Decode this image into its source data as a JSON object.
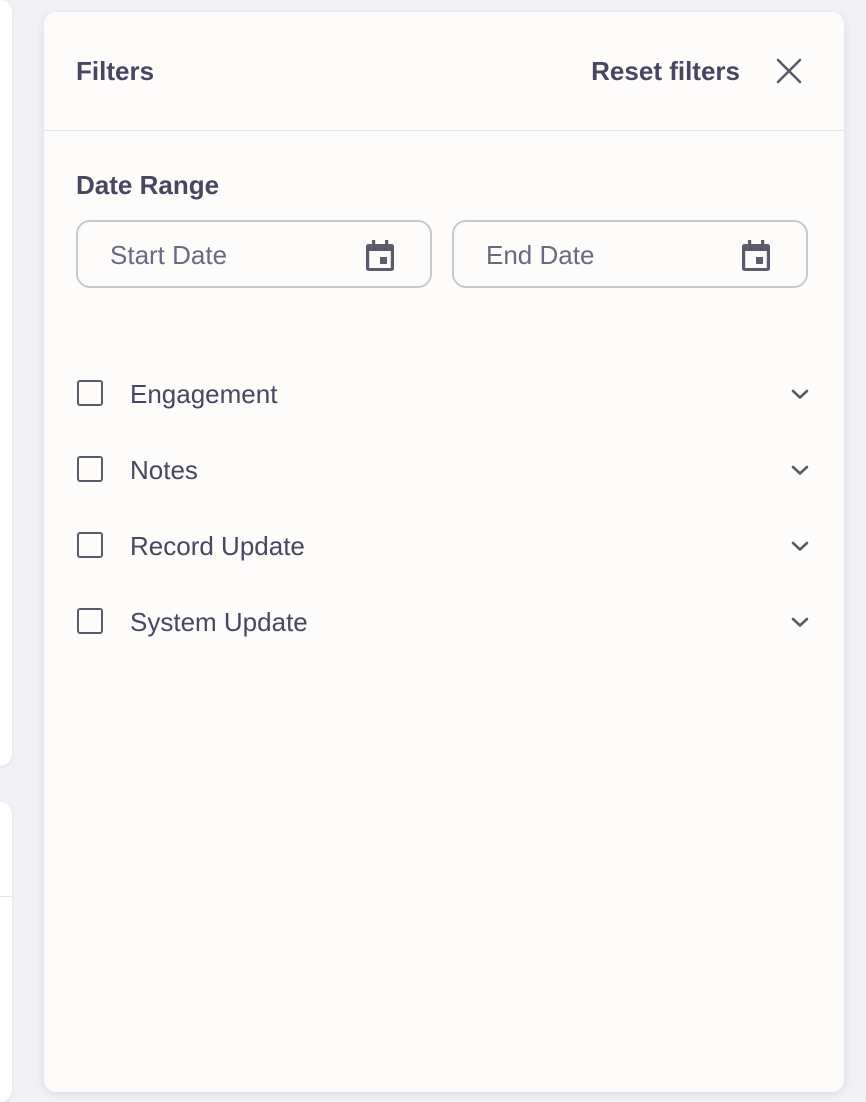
{
  "panel": {
    "title": "Filters",
    "reset_label": "Reset filters",
    "close_icon": "close-icon"
  },
  "date_range": {
    "label": "Date Range",
    "start_placeholder": "Start Date",
    "end_placeholder": "End Date",
    "icon": "calendar-icon"
  },
  "filters": [
    {
      "label": "Engagement",
      "checked": false
    },
    {
      "label": "Notes",
      "checked": false
    },
    {
      "label": "Record Update",
      "checked": false
    },
    {
      "label": "System Update",
      "checked": false
    }
  ],
  "colors": {
    "text": "#4a4560",
    "panel_bg": "#fdfcfa",
    "page_bg": "#f1f1f6",
    "border": "#c9c8cf"
  }
}
